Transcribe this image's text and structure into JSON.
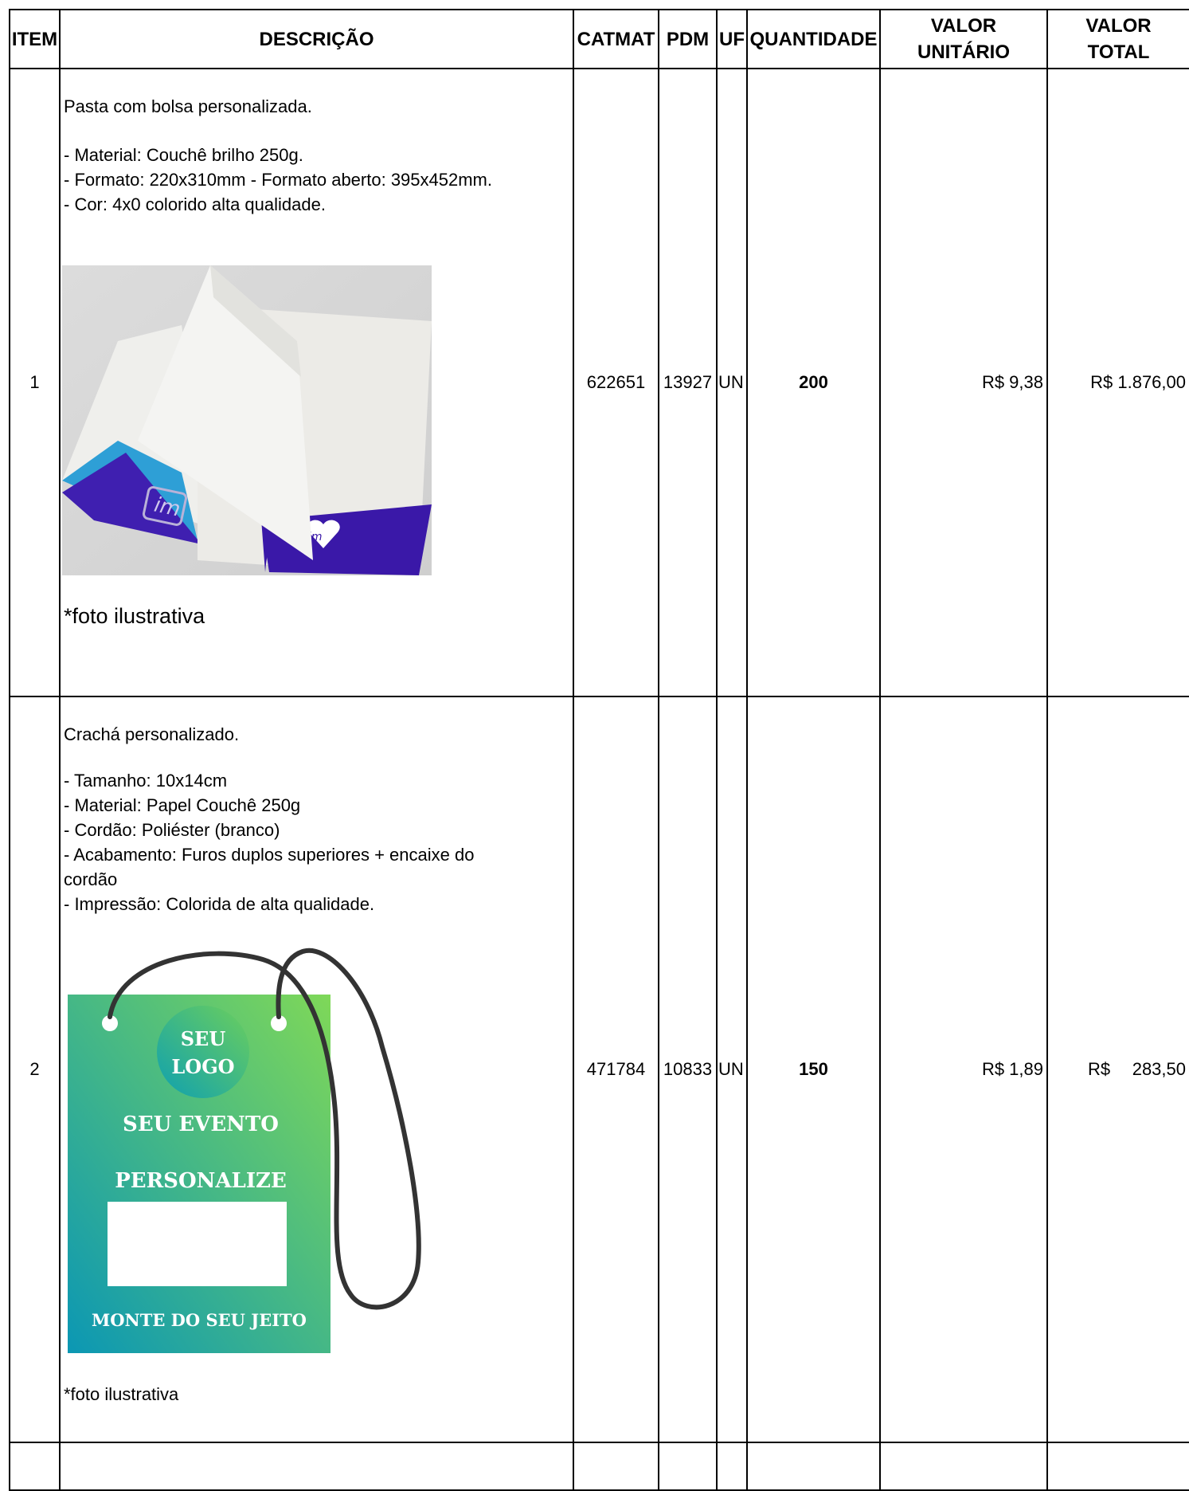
{
  "headers": {
    "item": "ITEM",
    "descricao": "DESCRIÇÃO",
    "catmat": "CATMAT",
    "pdm": "PDM",
    "uf": "UF",
    "quantidade": "QUANTIDADE",
    "valor_unitario_1": "VALOR",
    "valor_unitario_2": "UNITÁRIO",
    "valor_total_1": "VALOR",
    "valor_total_2": "TOTAL"
  },
  "rows": [
    {
      "item": "1",
      "title": "Pasta com bolsa personalizada.",
      "specs": [
        "- Material: Couchê brilho 250g.",
        "- Formato: 220x310mm - Formato aberto: 395x452mm.",
        "- Cor: 4x0 colorido alta qualidade."
      ],
      "image_logo_text": "im",
      "caption": "*foto ilustrativa",
      "catmat": "622651",
      "pdm": "13927",
      "uf": "UN",
      "quantidade": "200",
      "valor_unitario": "R$ 9,38",
      "valor_total": "R$ 1.876,00"
    },
    {
      "item": "2",
      "title": "Crachá personalizado.",
      "specs": [
        "- Tamanho: 10x14cm",
        "- Material: Papel Couchê 250g",
        "- Cordão: Poliéster (branco)",
        "- Acabamento: Furos duplos superiores + encaixe do",
        "cordão",
        "- Impressão: Colorida de alta qualidade."
      ],
      "badge_logo_1": "SEU",
      "badge_logo_2": "LOGO",
      "badge_event": "SEU EVENTO",
      "badge_personalize": "PERSONALIZE",
      "badge_footer": "MONTE DO SEU JEITO",
      "caption": "*foto ilustrativa",
      "catmat": "471784",
      "pdm": "10833",
      "uf": "UN",
      "quantidade": "150",
      "valor_total_prefix": "R$",
      "valor_unitario": "R$ 1,89",
      "valor_total": "283,50"
    }
  ]
}
